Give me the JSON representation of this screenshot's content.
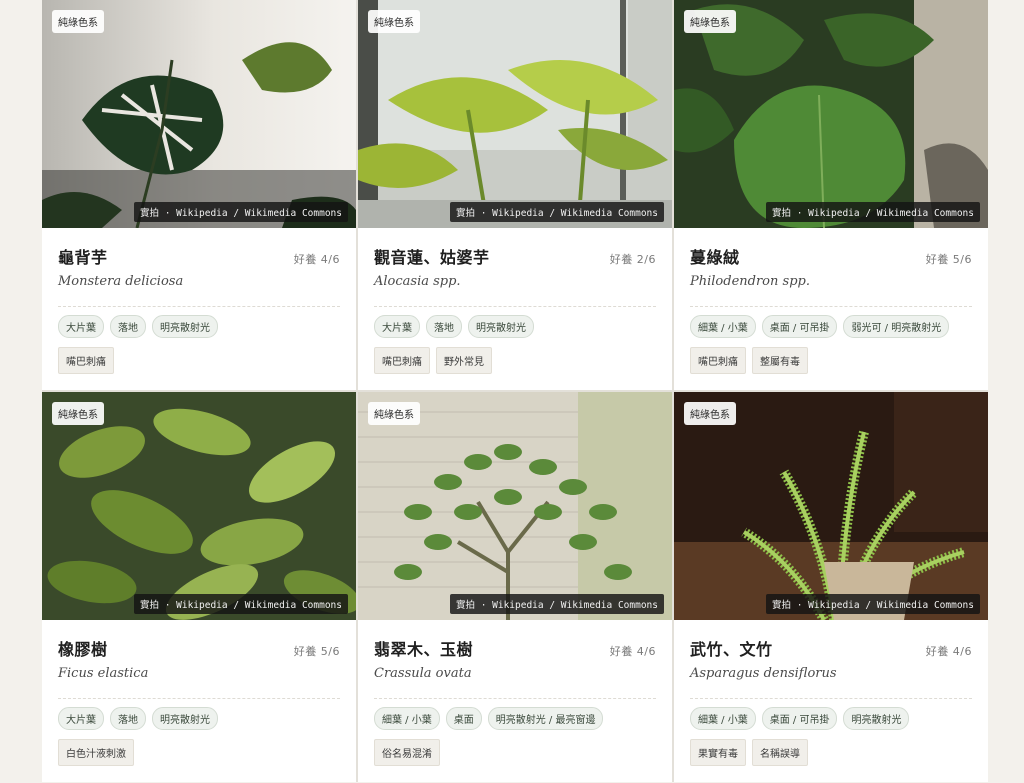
{
  "cards": [
    {
      "badge": "純綠色系",
      "credit": "實拍 · Wikipedia / Wikimedia Commons",
      "name": "龜背芋",
      "ease": "好養 4/6",
      "latin": "Monstera deliciosa",
      "tags": [
        "大片葉",
        "落地",
        "明亮散射光"
      ],
      "warnings": [
        "嘴巴刺痛"
      ]
    },
    {
      "badge": "純綠色系",
      "credit": "實拍 · Wikipedia / Wikimedia Commons",
      "name": "觀音蓮、姑婆芋",
      "ease": "好養 2/6",
      "latin": "Alocasia spp.",
      "tags": [
        "大片葉",
        "落地",
        "明亮散射光"
      ],
      "warnings": [
        "嘴巴刺痛",
        "野外常見"
      ]
    },
    {
      "badge": "純綠色系",
      "credit": "實拍 · Wikipedia / Wikimedia Commons",
      "name": "蔓綠絨",
      "ease": "好養 5/6",
      "latin": "Philodendron spp.",
      "tags": [
        "細葉 / 小葉",
        "桌面 / 可吊掛",
        "弱光可 / 明亮散射光"
      ],
      "warnings": [
        "嘴巴刺痛",
        "整屬有毒"
      ]
    },
    {
      "badge": "純綠色系",
      "credit": "實拍 · Wikipedia / Wikimedia Commons",
      "name": "橡膠樹",
      "ease": "好養 5/6",
      "latin": "Ficus elastica",
      "tags": [
        "大片葉",
        "落地",
        "明亮散射光"
      ],
      "warnings": [
        "白色汁液刺激"
      ]
    },
    {
      "badge": "純綠色系",
      "credit": "實拍 · Wikipedia / Wikimedia Commons",
      "name": "翡翠木、玉樹",
      "ease": "好養 4/6",
      "latin": "Crassula ovata",
      "tags": [
        "細葉 / 小葉",
        "桌面",
        "明亮散射光 / 最亮窗邊"
      ],
      "warnings": [
        "俗名易混淆"
      ]
    },
    {
      "badge": "純綠色系",
      "credit": "實拍 · Wikipedia / Wikimedia Commons",
      "name": "武竹、文竹",
      "ease": "好養 4/6",
      "latin": "Asparagus densiflorus",
      "tags": [
        "細葉 / 小葉",
        "桌面 / 可吊掛",
        "明亮散射光"
      ],
      "warnings": [
        "果實有毒",
        "名稱誤導"
      ]
    }
  ],
  "colors": {
    "page_bg": "#f3f1ec",
    "card_bg": "#ffffff",
    "tag_bg": "#eef2ee",
    "warn_bg": "#f1efea"
  },
  "icons": [
    "monstera-photo",
    "alocasia-photo",
    "philodendron-photo",
    "rubber-tree-photo",
    "jade-plant-photo",
    "asparagus-fern-photo"
  ]
}
